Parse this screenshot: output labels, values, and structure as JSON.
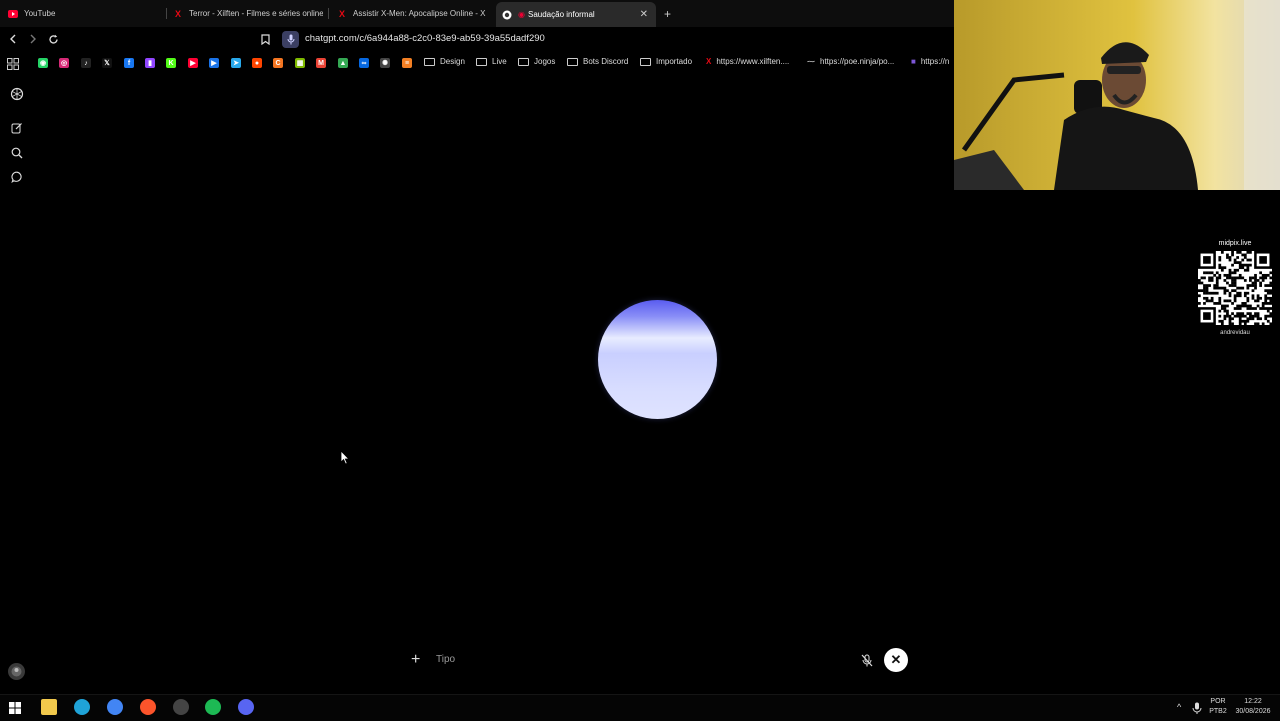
{
  "tabs": [
    {
      "title": "YouTube",
      "icon": "youtube-icon",
      "color": "#ff0033"
    },
    {
      "title": "Terror - Xilften - Filmes e séries online",
      "icon": "xilften-icon",
      "color": "#e50914"
    },
    {
      "title": "Assistir X-Men: Apocalipse Online - X",
      "icon": "xilften-icon",
      "color": "#e50914"
    },
    {
      "title": "Saudação informal",
      "icon": "chatgpt-icon",
      "active": true
    }
  ],
  "address": {
    "url": "chatgpt.com/c/6a944a88-c2c0-83e9-ab59-39a55dadf290"
  },
  "bookmarks": {
    "icons": [
      {
        "name": "whatsapp-icon",
        "color": "#25d366",
        "glyph": "◉"
      },
      {
        "name": "instagram-icon",
        "color": "#d62976",
        "glyph": "◎"
      },
      {
        "name": "tiktok-icon",
        "color": "#222222",
        "glyph": "♪"
      },
      {
        "name": "x-twitter-icon",
        "color": "#111111",
        "glyph": "𝕏"
      },
      {
        "name": "facebook-icon",
        "color": "#1877f2",
        "glyph": "f"
      },
      {
        "name": "twitch-icon",
        "color": "#9146ff",
        "glyph": "▮"
      },
      {
        "name": "kick-icon",
        "color": "#53fc18",
        "glyph": "K"
      },
      {
        "name": "youtube-icon",
        "color": "#ff0033",
        "glyph": "▶"
      },
      {
        "name": "play-icon",
        "color": "#1a73e8",
        "glyph": "▶"
      },
      {
        "name": "telegram-icon",
        "color": "#29a9eb",
        "glyph": "➤"
      },
      {
        "name": "reddit-icon",
        "color": "#ff4500",
        "glyph": "●"
      },
      {
        "name": "crunchyroll-icon",
        "color": "#f47521",
        "glyph": "C"
      },
      {
        "name": "microsoft-icon",
        "color": "#7fba00",
        "glyph": "▦"
      },
      {
        "name": "gmail-icon",
        "color": "#ea4335",
        "glyph": "M"
      },
      {
        "name": "drive-icon",
        "color": "#34a853",
        "glyph": "▲"
      },
      {
        "name": "meta-icon",
        "color": "#0668e1",
        "glyph": "∞"
      },
      {
        "name": "chatgpt-icon",
        "color": "#444444",
        "glyph": "✺"
      },
      {
        "name": "stackoverflow-icon",
        "color": "#f48024",
        "glyph": "≡"
      }
    ],
    "folders": [
      "Design",
      "Live",
      "Jogos",
      "Bots Discord",
      "Importado"
    ],
    "links": [
      "https://www.xilften....",
      "https://poe.ninja/po...",
      "https://n"
    ]
  },
  "main": {
    "input_placeholder": "Tipo"
  },
  "overlay": {
    "qr_title": "midpix.live",
    "qr_name": "andrevidau"
  },
  "taskbar": {
    "apps": [
      {
        "name": "file-explorer-icon",
        "color": "#f2c94c"
      },
      {
        "name": "edge-icon",
        "color": "#1fa3d8"
      },
      {
        "name": "chrome-icon",
        "color": "#4285f4"
      },
      {
        "name": "brave-icon",
        "color": "#fb542b"
      },
      {
        "name": "obs-icon",
        "color": "#444444"
      },
      {
        "name": "spotify-icon",
        "color": "#1db954"
      },
      {
        "name": "discord-icon",
        "color": "#5865f2"
      }
    ],
    "lang": "POR",
    "layout": "PTB2",
    "time": "12:22",
    "date": "30/08/2026"
  }
}
